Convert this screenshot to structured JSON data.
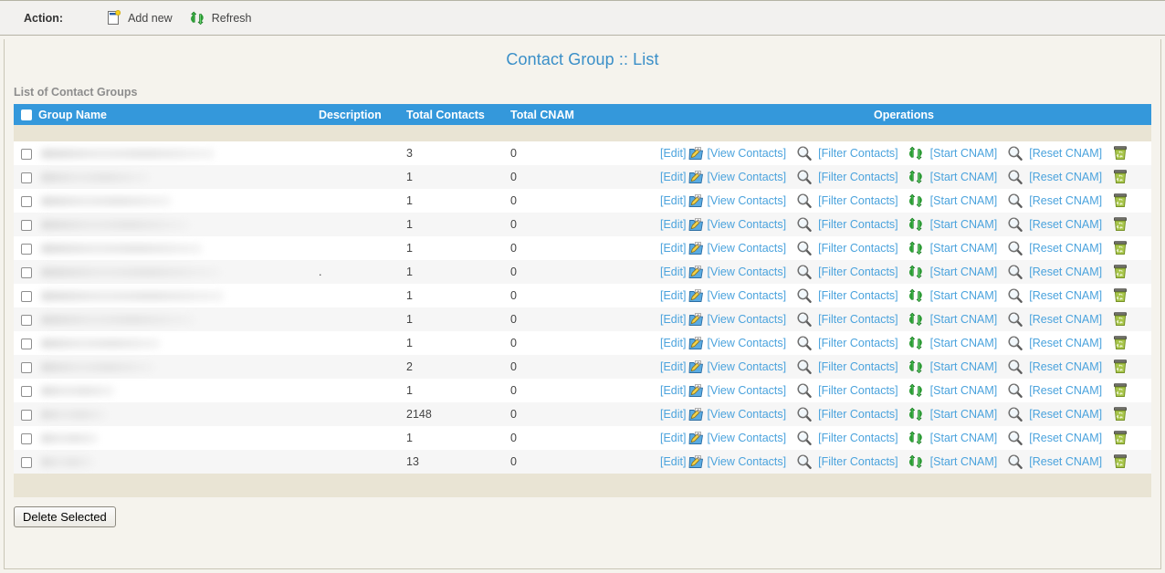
{
  "toolbar": {
    "action_label": "Action:",
    "add_new_label": "Add new",
    "refresh_label": "Refresh"
  },
  "page": {
    "title": "Contact Group :: List",
    "list_caption": "List of Contact Groups"
  },
  "table": {
    "columns": {
      "group_name": "Group Name",
      "description": "Description",
      "total_contacts": "Total Contacts",
      "total_cnam": "Total CNAM",
      "operations": "Operations"
    },
    "operations_labels": {
      "edit": "[Edit]",
      "view_contacts": "[View Contacts]",
      "filter_contacts": "[Filter Contacts]",
      "start_cnam": "[Start CNAM]",
      "reset_cnam": "[Reset CNAM]"
    },
    "rows": [
      {
        "group_name": "",
        "description": "",
        "total_contacts": "3",
        "total_cnam": "0",
        "name_width": 190
      },
      {
        "group_name": "",
        "description": "",
        "total_contacts": "1",
        "total_cnam": "0",
        "name_width": 118
      },
      {
        "group_name": "",
        "description": "",
        "total_contacts": "1",
        "total_cnam": "0",
        "name_width": 142
      },
      {
        "group_name": "",
        "description": "",
        "total_contacts": "1",
        "total_cnam": "0",
        "name_width": 162
      },
      {
        "group_name": "",
        "description": "",
        "total_contacts": "1",
        "total_cnam": "0",
        "name_width": 176
      },
      {
        "group_name": "",
        "description": ".",
        "total_contacts": "1",
        "total_cnam": "0",
        "name_width": 196
      },
      {
        "group_name": "",
        "description": "",
        "total_contacts": "1",
        "total_cnam": "0",
        "name_width": 200
      },
      {
        "group_name": "",
        "description": "",
        "total_contacts": "1",
        "total_cnam": "0",
        "name_width": 168
      },
      {
        "group_name": "",
        "description": "",
        "total_contacts": "1",
        "total_cnam": "0",
        "name_width": 130
      },
      {
        "group_name": "",
        "description": "",
        "total_contacts": "2",
        "total_cnam": "0",
        "name_width": 124
      },
      {
        "group_name": "",
        "description": "",
        "total_contacts": "1",
        "total_cnam": "0",
        "name_width": 80
      },
      {
        "group_name": "",
        "description": "",
        "total_contacts": "2148",
        "total_cnam": "0",
        "name_width": 72
      },
      {
        "group_name": "",
        "description": "",
        "total_contacts": "1",
        "total_cnam": "0",
        "name_width": 62
      },
      {
        "group_name": "",
        "description": "",
        "total_contacts": "13",
        "total_cnam": "0",
        "name_width": 58
      }
    ]
  },
  "footer": {
    "delete_selected_label": "Delete Selected"
  },
  "colors": {
    "header_blue": "#3498db",
    "link_blue": "#4ba3dd",
    "title_blue": "#3a8fc8",
    "strip_beige": "#e9e4d4",
    "page_bg": "#f5f3ed"
  },
  "icons": {
    "add_new": "new-document-icon",
    "refresh": "refresh-arrows-icon",
    "view_contacts": "folder-edit-icon",
    "filter_contacts": "magnifier-icon",
    "start_cnam": "refresh-arrows-icon",
    "reset_cnam": "magnifier-icon",
    "delete_row": "recycle-bin-icon"
  }
}
